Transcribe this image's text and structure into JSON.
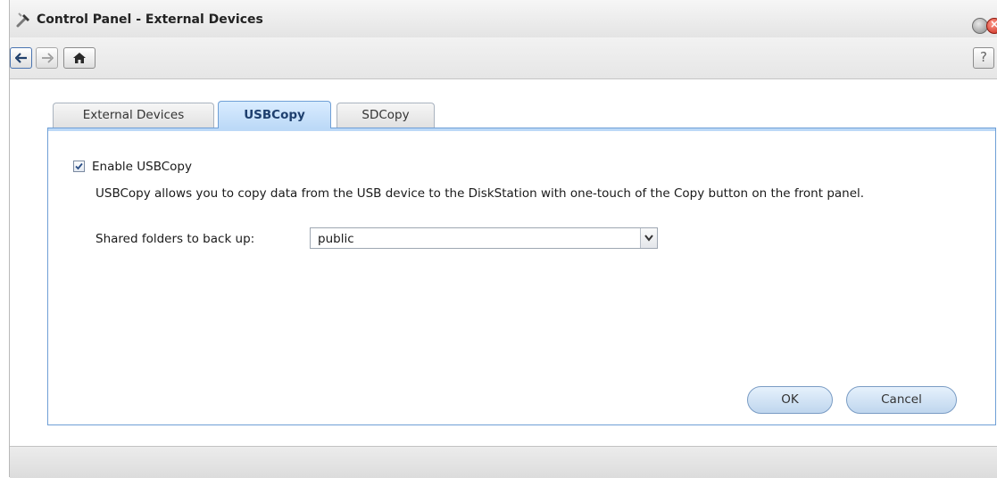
{
  "window": {
    "title": "Control Panel - External Devices",
    "help_label": "?"
  },
  "tabs": [
    {
      "label": "External Devices",
      "active": false
    },
    {
      "label": "USBCopy",
      "active": true
    },
    {
      "label": "SDCopy",
      "active": false
    }
  ],
  "usbcopy": {
    "enable_label": "Enable USBCopy",
    "enabled": true,
    "description": "USBCopy allows you to copy data from the USB device to the DiskStation with one-touch of the Copy button on the front panel.",
    "shared_folders_label": "Shared folders to back up:",
    "shared_folder_value": "public"
  },
  "buttons": {
    "ok": "OK",
    "cancel": "Cancel"
  },
  "colors": {
    "accent": "#6f9fd6",
    "active_tab": "#bcd9f7",
    "close": "#c8271a"
  },
  "icons": [
    "tools-icon",
    "back-arrow-icon",
    "forward-arrow-icon",
    "home-icon",
    "help-icon",
    "minimize-icon",
    "close-icon",
    "checkmark-icon",
    "chevron-down-icon"
  ]
}
